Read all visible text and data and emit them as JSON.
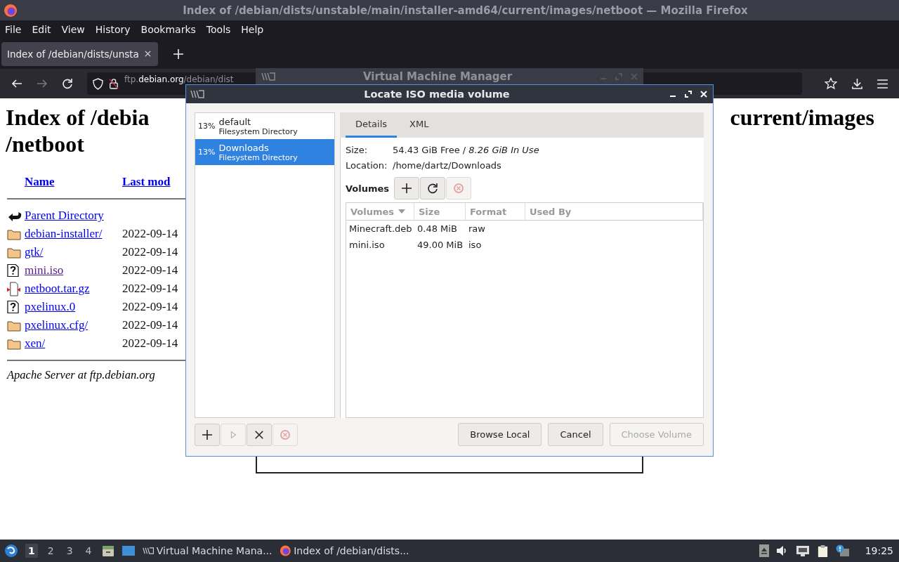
{
  "firefox": {
    "title": "Index of /debian/dists/unstable/main/installer-amd64/current/images/netboot — Mozilla Firefox",
    "menu": [
      "File",
      "Edit",
      "View",
      "History",
      "Bookmarks",
      "Tools",
      "Help"
    ],
    "tabs": [
      {
        "label": "Index of /debian/dists/unsta",
        "selected": true
      }
    ],
    "url": {
      "prefix": "ftp.",
      "domain": "debian.org",
      "path": "/debian/dist"
    }
  },
  "page": {
    "heading_start": "Index of /debia",
    "heading_end": "current/images",
    "heading_line2": "/netboot",
    "columns": [
      "Name",
      "Last mod"
    ],
    "rows": [
      {
        "kind": "parent",
        "name": "Parent Directory",
        "visited": false
      },
      {
        "kind": "folder",
        "name": "debian-installer/",
        "date": "2022-09-14",
        "visited": false
      },
      {
        "kind": "folder",
        "name": "gtk/",
        "date": "2022-09-14",
        "visited": false
      },
      {
        "kind": "unknown",
        "name": "mini.iso",
        "date": "2022-09-14",
        "visited": true
      },
      {
        "kind": "archive",
        "name": "netboot.tar.gz",
        "date": "2022-09-14",
        "visited": false
      },
      {
        "kind": "unknown",
        "name": "pxelinux.0",
        "date": "2022-09-14",
        "visited": false
      },
      {
        "kind": "folder",
        "name": "pxelinux.cfg/",
        "date": "2022-09-14",
        "visited": false
      },
      {
        "kind": "folder",
        "name": "xen/",
        "date": "2022-09-14",
        "visited": false
      }
    ],
    "footer": "Apache Server at ftp.debian.org"
  },
  "vmm": {
    "title": "Virtual Machine Manager"
  },
  "dialog": {
    "title": "Locate ISO media volume",
    "pools": [
      {
        "usage": "13%",
        "name": "default",
        "type": "Filesystem Directory",
        "selected": false
      },
      {
        "usage": "13%",
        "name": "Downloads",
        "type": "Filesystem Directory",
        "selected": true
      }
    ],
    "tabs": [
      {
        "label": "Details",
        "selected": true
      },
      {
        "label": "XML",
        "selected": false
      }
    ],
    "size_label": "Size:",
    "size_value": "54.43 GiB Free / *8.26 GiB In Use*",
    "location_label": "Location:",
    "location": "/home/dartz/Downloads",
    "volumes_label": "Volumes",
    "volume_tools": [
      {
        "kind": "add",
        "disabled": false
      },
      {
        "kind": "refresh",
        "disabled": false
      },
      {
        "kind": "delete",
        "disabled": true
      }
    ],
    "columns": [
      {
        "label": "Volumes",
        "sorted": true
      },
      {
        "label": "Size",
        "sorted": false
      },
      {
        "label": "Format",
        "sorted": false
      },
      {
        "label": "Used By",
        "sorted": false
      }
    ],
    "rows": [
      [
        "Minecraft.deb",
        "0.48 MiB",
        "raw"
      ],
      [
        "mini.iso",
        "49.00 MiB",
        "iso"
      ]
    ],
    "pool_tools": [
      {
        "kind": "add",
        "disabled": false
      },
      {
        "kind": "start",
        "disabled": true
      },
      {
        "kind": "stop",
        "disabled": false
      },
      {
        "kind": "delete",
        "disabled": true
      }
    ],
    "actions": [
      {
        "label": "Browse Local",
        "disabled": false
      },
      {
        "label": "Cancel",
        "disabled": false
      },
      {
        "label": "Choose Volume",
        "disabled": true
      }
    ]
  },
  "taskbar": {
    "workspaces": [
      {
        "label": "1",
        "selected": true
      },
      {
        "label": "2",
        "selected": false
      },
      {
        "label": "3",
        "selected": false
      },
      {
        "label": "4",
        "selected": false
      }
    ],
    "tasks": [
      {
        "kind": "vmm",
        "label": "Virtual Machine Mana..."
      },
      {
        "kind": "firefox",
        "label": "Index of /debian/dists..."
      }
    ],
    "clock": "19:25"
  }
}
